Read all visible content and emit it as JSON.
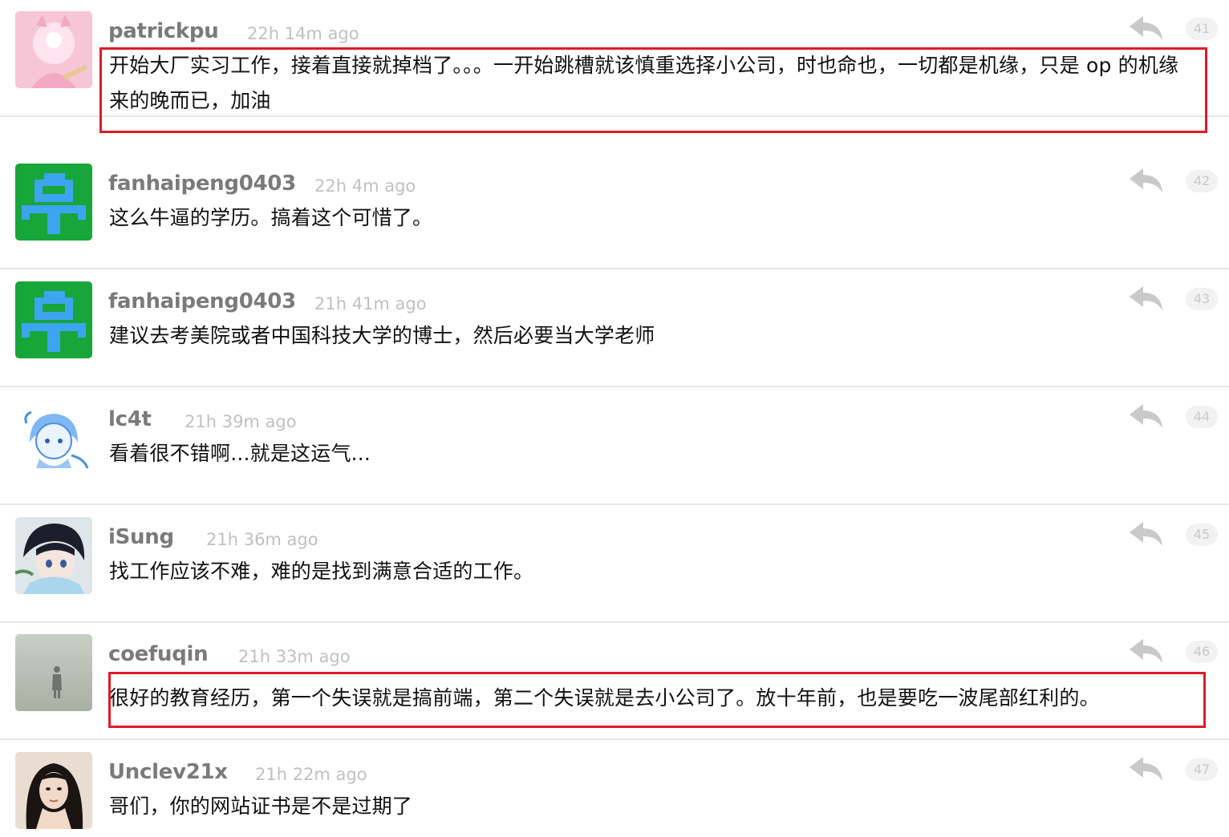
{
  "replies": [
    {
      "username": "patrickpu",
      "time": "22h 14m ago",
      "floor": "41",
      "content": "开始大厂实习工作，接着直接就掉档了。。。一开始跳槽就该慎重选择小公司，时也命也，一切都是机缘，只是 op 的机缘来的晚而已，加油",
      "avatar": "pink-cat-avatar"
    },
    {
      "username": "fanhaipeng0403",
      "time": "22h 4m ago",
      "floor": "42",
      "content": "这么牛逼的学历。搞着这个可惜了。",
      "avatar": "green-pixel-avatar"
    },
    {
      "username": "fanhaipeng0403",
      "time": "21h 41m ago",
      "floor": "43",
      "content": "建议去考美院或者中国科技大学的博士，然后必要当大学老师",
      "avatar": "green-pixel-avatar"
    },
    {
      "username": "lc4t",
      "time": "21h 39m ago",
      "floor": "44",
      "content": "看着很不错啊...就是这运气...",
      "avatar": "blue-anime-avatar"
    },
    {
      "username": "iSung",
      "time": "21h 36m ago",
      "floor": "45",
      "content": "找工作应该不难，难的是找到满意合适的工作。",
      "avatar": "anime-boy-avatar"
    },
    {
      "username": "coefuqin",
      "time": "21h 33m ago",
      "floor": "46",
      "content": "很好的教育经历，第一个失误就是搞前端，第二个失误就是去小公司了。放十年前，也是要吃一波尾部红利的。",
      "avatar": "foggy-figure-avatar"
    },
    {
      "username": "Unclev21x",
      "time": "21h 22m ago",
      "floor": "47",
      "content": "哥们，你的网站证书是不是过期了",
      "avatar": "woman-portrait-avatar"
    }
  ],
  "colors": {
    "highlight": "#e01b24",
    "username": "#7a7a7a",
    "timestamp": "#c0c0c0",
    "content": "#111111"
  },
  "icons": {
    "reply": "reply-arrow-icon"
  }
}
